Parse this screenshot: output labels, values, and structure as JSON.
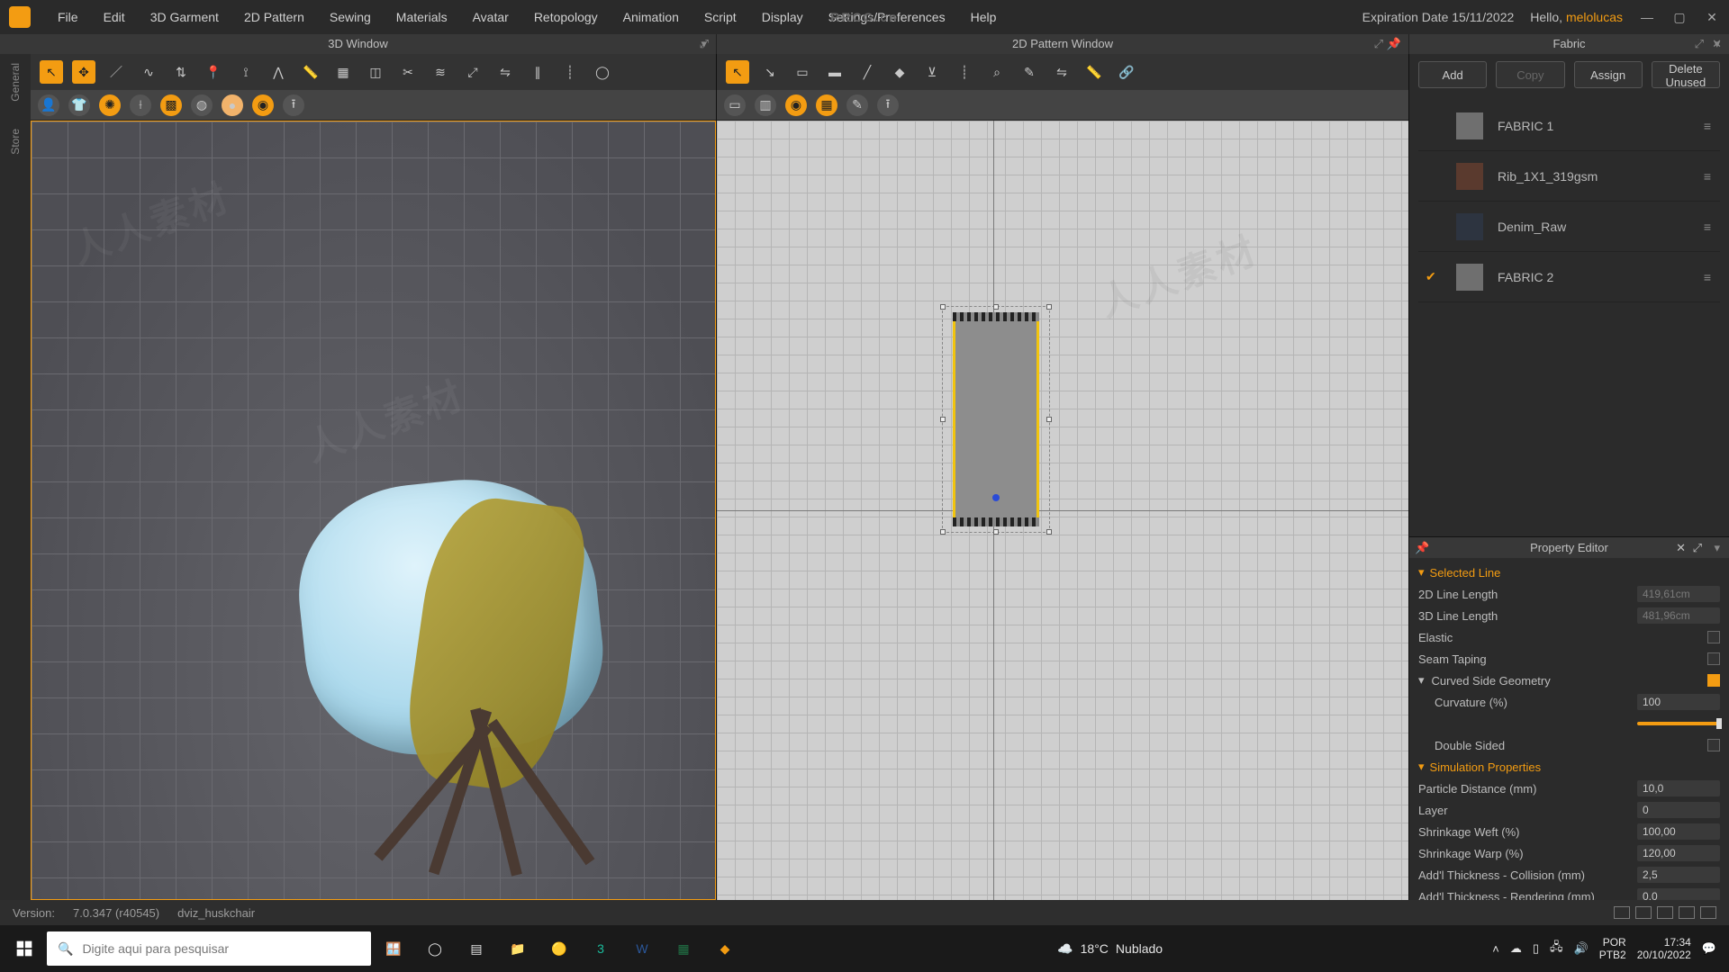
{
  "menu": {
    "items": [
      "File",
      "Edit",
      "3D Garment",
      "2D Pattern",
      "Sewing",
      "Materials",
      "Avatar",
      "Retopology",
      "Animation",
      "Script",
      "Display",
      "Settings/Preferences",
      "Help"
    ]
  },
  "titlebar": {
    "watermark": "RRCG.cn",
    "expiration_label": "Expiration Date 15/11/2022",
    "hello_prefix": "Hello, ",
    "username": "melolucas"
  },
  "tabs": {
    "win3d": "3D Window",
    "win2d": "2D Pattern Window",
    "fabric": "Fabric"
  },
  "leftrail": {
    "general": "General",
    "store": "Store"
  },
  "fabric_panel": {
    "actions": {
      "add": "Add",
      "copy": "Copy",
      "assign": "Assign",
      "delete_unused": "Delete Unused"
    },
    "items": [
      {
        "name": "FABRIC 1",
        "swatch": "#6f6f6f",
        "selected": false
      },
      {
        "name": "Rib_1X1_319gsm",
        "swatch": "#5a3a2e",
        "selected": false
      },
      {
        "name": "Denim_Raw",
        "swatch": "#2d3440",
        "selected": false
      },
      {
        "name": "FABRIC 2",
        "swatch": "#6f6f6f",
        "selected": true
      }
    ]
  },
  "property_editor": {
    "title": "Property Editor",
    "selected_line": "Selected Line",
    "rows": {
      "line2d_label": "2D Line Length",
      "line2d_value": "419,61cm",
      "line3d_label": "3D Line Length",
      "line3d_value": "481,96cm",
      "elastic_label": "Elastic",
      "seam_label": "Seam Taping",
      "curved_label": "Curved Side Geometry",
      "curvature_label": "Curvature (%)",
      "curvature_value": "100",
      "double_sided_label": "Double Sided",
      "sim_label": "Simulation Properties",
      "particle_label": "Particle Distance (mm)",
      "particle_value": "10,0",
      "layer_label": "Layer",
      "layer_value": "0",
      "shrink_weft_label": "Shrinkage Weft (%)",
      "shrink_weft_value": "100,00",
      "shrink_warp_label": "Shrinkage Warp (%)",
      "shrink_warp_value": "120,00",
      "thick_coll_label": "Add'l Thickness - Collision (mm)",
      "thick_coll_value": "2,5",
      "thick_rend_label": "Add'l Thickness - Rendering (mm)",
      "thick_rend_value": "0,0"
    }
  },
  "statusbar": {
    "version_label": "Version:",
    "version": "7.0.347 (r40545)",
    "filename": "dviz_huskchair"
  },
  "taskbar": {
    "search_placeholder": "Digite aqui para pesquisar",
    "weather_temp": "18°C",
    "weather_desc": "Nublado",
    "lang": "POR",
    "kb": "PTB2",
    "time": "17:34",
    "date": "20/10/2022"
  }
}
